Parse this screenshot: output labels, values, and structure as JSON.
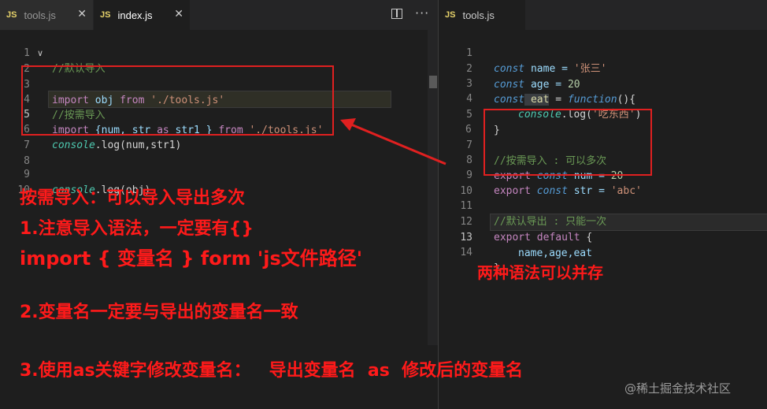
{
  "left_editor": {
    "tabs": [
      {
        "icon": "JS",
        "label": "tools.js",
        "close": "✕"
      },
      {
        "icon": "JS",
        "label": "index.js",
        "close": "✕"
      }
    ],
    "more": "···",
    "lines": [
      {
        "n": "1"
      },
      {
        "n": "2"
      },
      {
        "n": "3"
      },
      {
        "n": "4"
      },
      {
        "n": "5"
      },
      {
        "n": "6"
      },
      {
        "n": "7"
      },
      {
        "n": "8"
      },
      {
        "n": "9"
      },
      {
        "n": "10"
      }
    ],
    "tokens": {
      "l1": "//默认导入",
      "l2a": "import",
      "l2b": " obj ",
      "l2c": "from",
      "l2d": " './tools.js'",
      "l4": "//按需导入",
      "l5a": "import",
      "l5b": " {num, str ",
      "l5c": "as",
      "l5d": " str1 }",
      "l5e": " from",
      "l5f": " './tools.js'",
      "l6a": "console",
      "l6b": ".log(num,str1)",
      "l9a": "console",
      "l9b": ".log(obj)"
    }
  },
  "right_editor": {
    "tab": {
      "icon": "JS",
      "label": "tools.js"
    },
    "lines": [
      {
        "n": "1"
      },
      {
        "n": "2"
      },
      {
        "n": "3"
      },
      {
        "n": "4"
      },
      {
        "n": "5"
      },
      {
        "n": "6"
      },
      {
        "n": "7"
      },
      {
        "n": "8"
      },
      {
        "n": "9"
      },
      {
        "n": "10"
      },
      {
        "n": "11"
      },
      {
        "n": "12"
      },
      {
        "n": "13"
      },
      {
        "n": "14"
      }
    ],
    "tokens": {
      "r1a": "const",
      "r1b": " name = ",
      "r1c": "'张三'",
      "r2a": "const",
      "r2b": " age = ",
      "r2c": "20",
      "r3a": "const",
      "r3b": " eat",
      "r3c": " = ",
      "r3d": "function",
      "r3e": "(){",
      "r4a": "console",
      "r4b": ".log(",
      "r4c": "'吃东西'",
      "r4d": ")",
      "r5": "}",
      "r7": "//按需导入 : 可以多次",
      "r8a": "export",
      "r8b": " const",
      "r8c": " num = ",
      "r8d": "20",
      "r9a": "export",
      "r9b": " const",
      "r9c": " str = ",
      "r9d": "'abc'",
      "r11": "//默认导出 : 只能一次",
      "r12a": "export",
      "r12b": " default",
      "r12c": " {",
      "r13": "name,age,eat",
      "r14": "}"
    }
  },
  "annotations": {
    "n1": "按需导入：可以导入导出多次",
    "n2": "1.注意导入语法，一定要有{}",
    "n3": "import { 变量名 } form 'js文件路径'",
    "n4": "2.变量名一定要与导出的变量名一致",
    "n5": "3.使用as关键字修改变量名：   导出变量名  as  修改后的变量名",
    "n6": "两种语法可以并存"
  },
  "watermark": "@稀土掘金技术社区",
  "colors": {
    "annotation_red": "#ff1a1a",
    "keyword_purple": "#c586c0",
    "string": "#ce9178",
    "comment": "#6a9955"
  }
}
